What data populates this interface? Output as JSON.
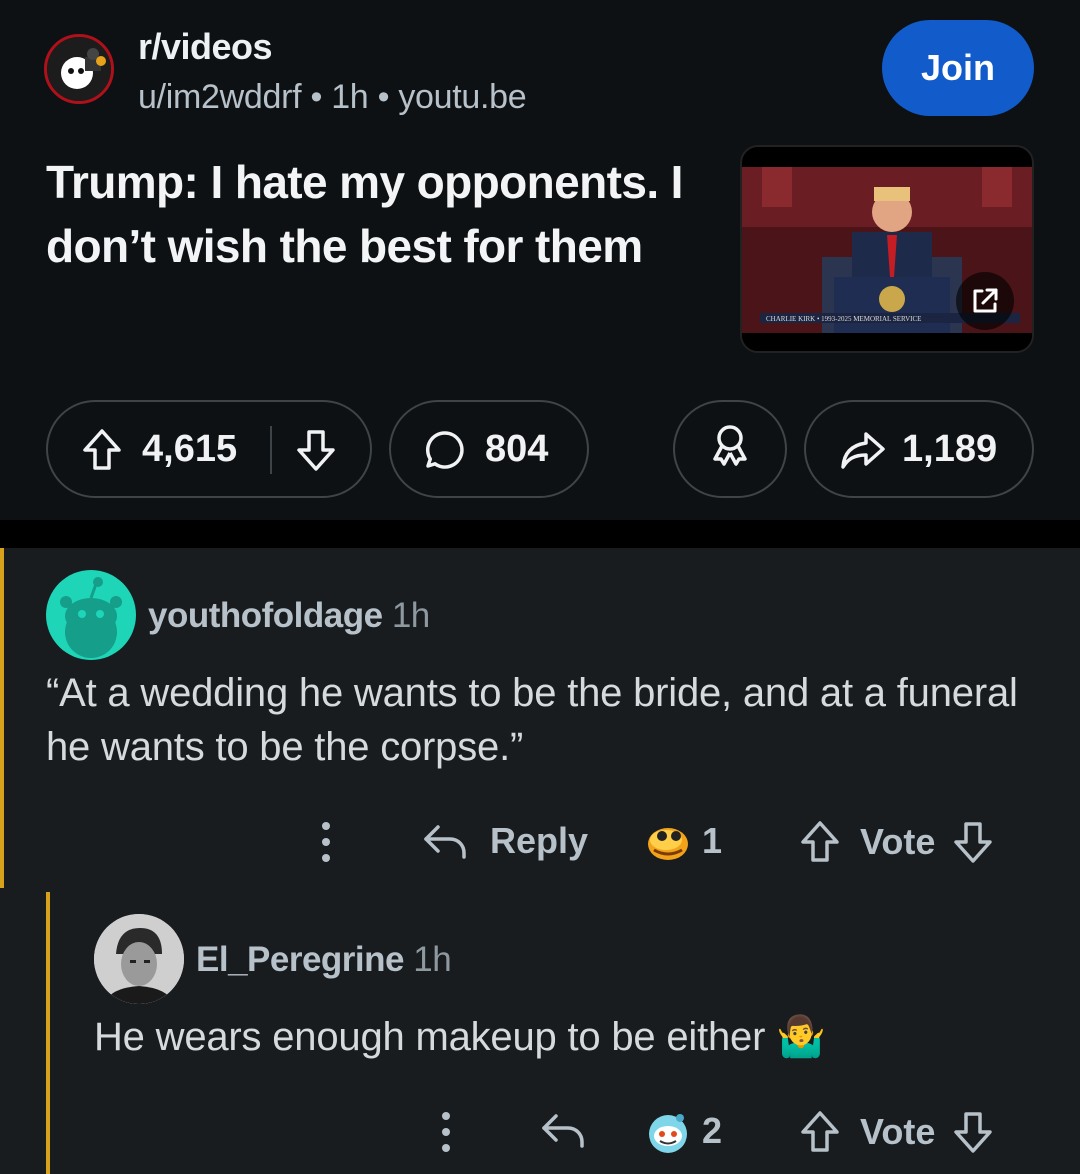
{
  "post": {
    "subreddit": "r/videos",
    "author": "u/im2wddrf",
    "time": "1h",
    "domain": "youtu.be",
    "join_label": "Join",
    "title": "Trump: I hate my opponents. I don’t wish the best for them",
    "thumbnail_caption": "CHARLIE KIRK • 1993-2025 MEMORIAL SERVICE",
    "upvotes": "4,615",
    "comments": "804",
    "shares": "1,189"
  },
  "comments": [
    {
      "user": "youthofoldage",
      "time": "1h",
      "body": "“At a wedding he wants to be the bride, and at a funeral he wants to be the corpse.”",
      "reply_label": "Reply",
      "award_count": "1",
      "vote_label": "Vote"
    },
    {
      "user": "El_Peregrine",
      "time": "1h",
      "body": "He wears enough makeup to be either 🤷‍♂️",
      "award_count": "2",
      "vote_label": "Vote"
    }
  ],
  "icons": [
    "upvote-icon",
    "downvote-icon",
    "comment-icon",
    "award-icon",
    "share-icon",
    "external-link-icon",
    "more-icon",
    "reply-icon"
  ],
  "colors": {
    "join": "#115bca",
    "thread": "#d7a21b",
    "avatar_teal": "#1ed5b8"
  }
}
